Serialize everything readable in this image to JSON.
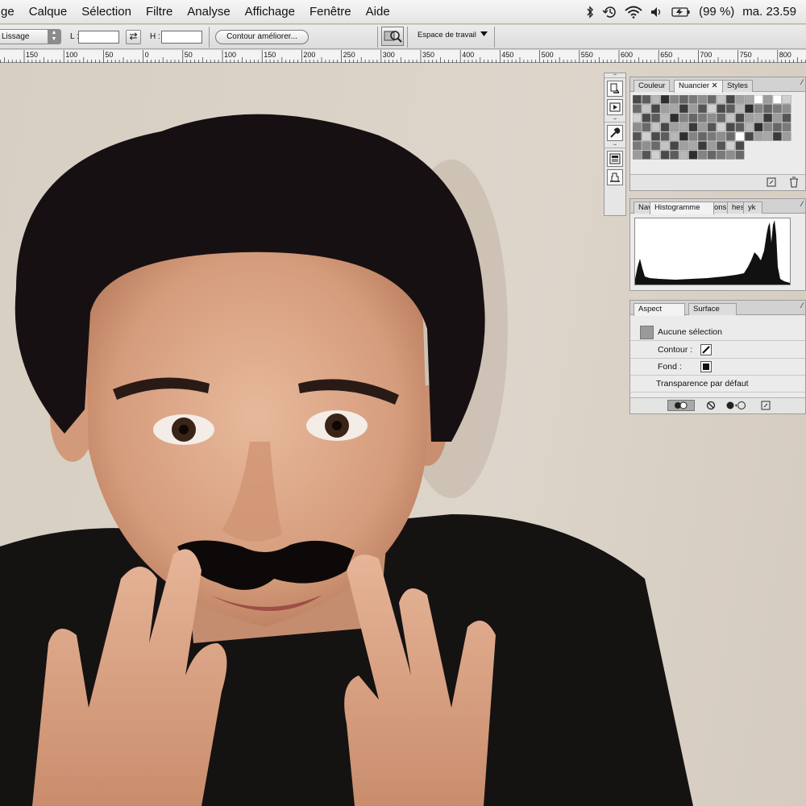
{
  "menubar": {
    "items": [
      "ge",
      "Calque",
      "Sélection",
      "Filtre",
      "Analyse",
      "Affichage",
      "Fenêtre",
      "Aide"
    ],
    "battery": "(99 %)",
    "clock": "ma. 23.59"
  },
  "options": {
    "smoothing_label": "Lissage",
    "width_label": "L :",
    "height_label": "H :",
    "refine_edge": "Contour améliorer...",
    "workspace": "Espace de travail"
  },
  "ruler": {
    "labels": [
      "150",
      "100",
      "50",
      "0",
      "50",
      "100",
      "150",
      "200",
      "250",
      "300",
      "350",
      "400",
      "450",
      "500",
      "550",
      "600",
      "650",
      "700",
      "750",
      "800"
    ]
  },
  "panels": {
    "color": {
      "tabs": [
        "Couleur",
        "Nuancier",
        "Styles"
      ]
    },
    "histogram": {
      "tabs": [
        "Nav",
        "Histogramme",
        "ons",
        "hes",
        "yk"
      ]
    },
    "aspect": {
      "tabs": [
        "Aspect",
        "Surface"
      ],
      "selection": "Aucune sélection",
      "stroke_label": "Contour :",
      "fill_label": "Fond :",
      "transparency": "Transparence par défaut"
    }
  },
  "icons": [
    "bluetooth-icon",
    "time-machine-icon",
    "wifi-icon",
    "volume-icon",
    "battery-icon",
    "dropdown-arrow-icon",
    "swap-icon",
    "bridge-icon",
    "history-icon",
    "actions-icon",
    "tool-presets-icon",
    "layer-comps-icon",
    "clone-source-icon",
    "new-swatch-icon",
    "trash-icon",
    "no-color-icon"
  ],
  "colors": {
    "menubar_bg": "#ececec",
    "panel_bg": "#ebebeb",
    "photo_background": "#d8cfc3"
  }
}
